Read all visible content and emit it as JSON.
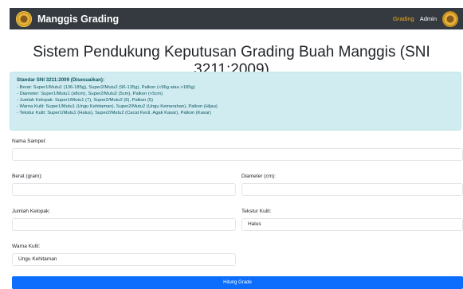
{
  "navbar": {
    "brand": "Manggis Grading",
    "links": [
      "Grading",
      "Admin"
    ]
  },
  "page_title": "Sistem Pendukung Keputusan Grading Buah Manggis (SNI 3211:2009)",
  "info": {
    "title": "Standar SNI 3211:2009 (Disesuaikan):",
    "lines": [
      "- Berat: Super1/Mutu1 (136-185g), Super2/Mutu2 (96-135g), Palkon (<96g atau >185g)",
      "- Diameter: Super1/Mutu1 (≥8cm), Super2/Mutu2 (5cm), Palkon (<5cm)",
      "- Jumlah Kelopak: Super1/Mutu1 (7), Super2/Mutu2 (6), Palkon (5)",
      "- Warna Kulit: Super1/Mutu1 (Ungu Kehitaman), Super2/Mutu2 (Ungu Kemerahan), Palkon (Hijau)",
      "- Tekstur Kulit: Super1/Mutu1 (Halus), Super2/Mutu2 (Cacat Kecil, Agak Kasar), Palkon (Kasar)"
    ]
  },
  "form": {
    "nama_sampel": {
      "label": "Nama Sampel:",
      "value": ""
    },
    "berat": {
      "label": "Berat (gram):",
      "value": ""
    },
    "diameter": {
      "label": "Diameter (cm):",
      "value": ""
    },
    "jumlah_kelopak": {
      "label": "Jumlah Kelopak:",
      "value": ""
    },
    "tekstur_kulit": {
      "label": "Tekstur Kulit:",
      "value": "Halus"
    },
    "warna_kulit": {
      "label": "Warna Kulit:",
      "value": "Ungu Kehitaman"
    },
    "submit_label": "Hitung Grade"
  },
  "colors": {
    "navbar_bg": "#343a40",
    "active_link": "#f0ad1d",
    "info_bg": "#d1ecf1",
    "info_text": "#0c5460",
    "button_bg": "#0d6efd"
  },
  "icons": [
    "manggis-logo-icon",
    "admin-avatar-icon"
  ]
}
